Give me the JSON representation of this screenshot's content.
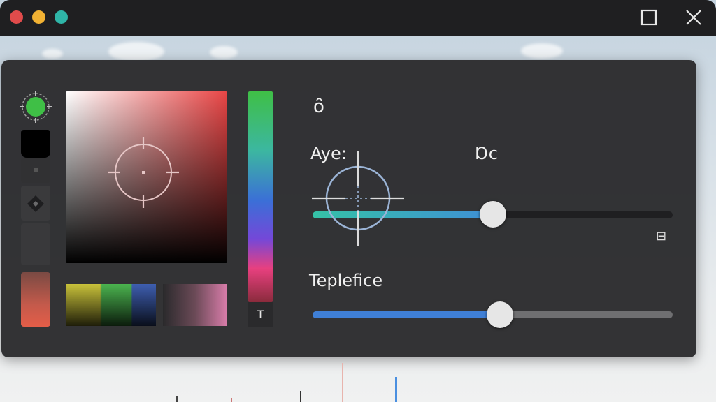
{
  "window": {
    "traffic_colors": {
      "close": "#e14b4b",
      "minimize": "#f2b233",
      "zoom": "#2fb5a8"
    }
  },
  "picker": {
    "current_color": "#3fbf46",
    "swatches": [
      "#c9c23a",
      "#4bb44f",
      "#3e5eb0"
    ],
    "hue_button_label": "T"
  },
  "controls": {
    "value_glyph": "ȏ",
    "slider1": {
      "label": "Aye:",
      "value_text": "Ɒc",
      "value": 0.5
    },
    "end_icon_glyph": "⊟",
    "slider2": {
      "label": "Teplefice",
      "value": 0.52
    }
  }
}
